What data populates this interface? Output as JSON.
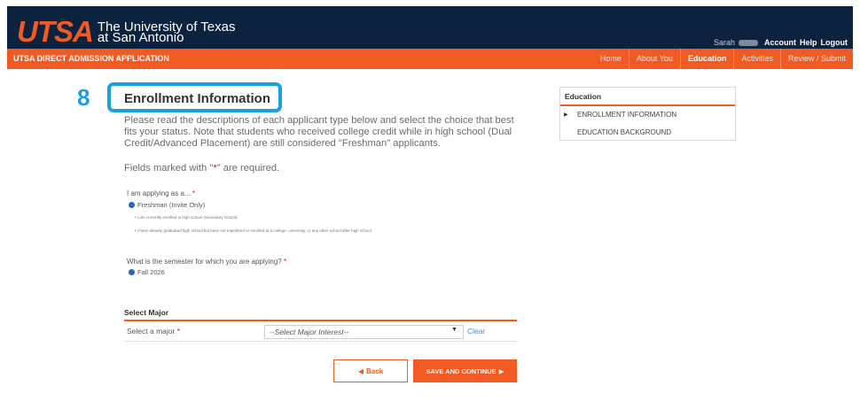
{
  "header": {
    "logo_mark": "UTSA",
    "logo_line1": "The University of Texas",
    "logo_line2": "at San Antonio",
    "user_name": "Sarah",
    "links": [
      "Account",
      "Help",
      "Logout"
    ]
  },
  "nav": {
    "app_title": "UTSA DIRECT ADMISSION APPLICATION",
    "items": [
      "Home",
      "About You",
      "Education",
      "Activities",
      "Review / Submit"
    ],
    "active": "Education"
  },
  "step": {
    "number": "8",
    "title": "Enrollment Information"
  },
  "content": {
    "description": "Please read the descriptions of each applicant type below and select the choice that best fits your status. Note that students who received college credit while in high school (Dual Credit/Advanced Placement) are still considered \"Freshman\" applicants.",
    "fields_note_prefix": "Fields marked with \"",
    "fields_note_star": "*",
    "fields_note_suffix": "\" are required.",
    "applying_as_label": "I am applying as a...",
    "applying_as_option": "Freshman (Invite Only)",
    "bullets": [
      "I am currently enrolled in high school (secondary school).",
      "I have already graduated high school but have not registered or enrolled at a college, university, or any other school after high school."
    ],
    "semester_label": "What is the semester for which you are applying?",
    "semester_option": "Fall 2026",
    "required_star": "*"
  },
  "major": {
    "section_title": "Select Major",
    "label": "Select a major",
    "select_value": "--Select Major Interest--",
    "clear": "Clear"
  },
  "buttons": {
    "back": "Back",
    "save": "SAVE AND CONTINUE"
  },
  "sidebar": {
    "title": "Education",
    "items": [
      "ENROLLMENT INFORMATION",
      "EDUCATION BACKGROUND"
    ]
  },
  "colors": {
    "navy": "#0c2340",
    "orange": "#f15a22",
    "highlight_blue": "#1ba0e2"
  }
}
